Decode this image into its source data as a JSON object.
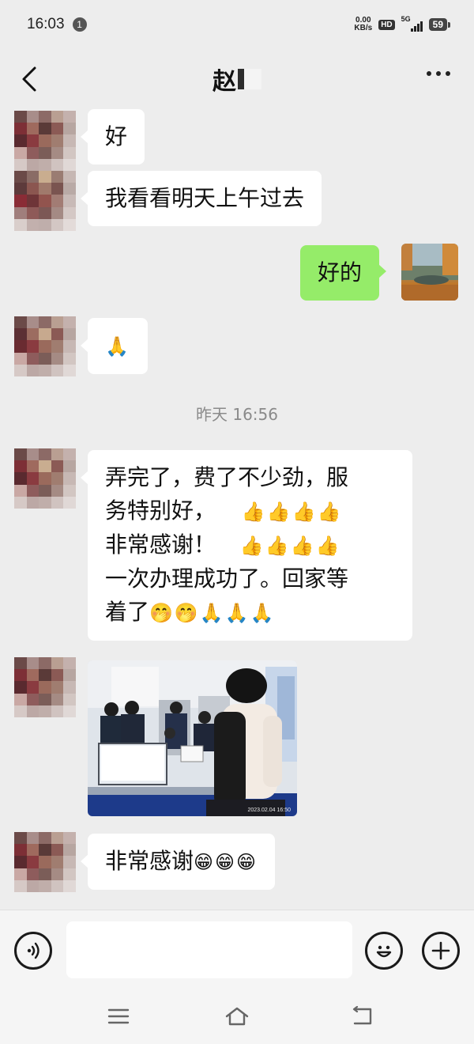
{
  "status_bar": {
    "time": "16:03",
    "notification_count": "1",
    "net_speed_value": "0.00",
    "net_speed_unit": "KB/s",
    "hd_label": "HD",
    "network_label": "5G",
    "battery_level": "59"
  },
  "header": {
    "title": "赵",
    "back_icon": "chevron-left-icon",
    "more_icon": "ellipsis-icon"
  },
  "messages": [
    {
      "side": "left",
      "text": "好"
    },
    {
      "side": "left",
      "text": "我看看明天上午过去"
    },
    {
      "side": "right",
      "text": "好的"
    },
    {
      "side": "left",
      "emoji": "🙏"
    }
  ],
  "timestamp": "昨天 16:56",
  "long_message": {
    "line1": "弄完了，费了不少劲，服",
    "line2_text": "务特别好，",
    "line2_emoji": "👍👍👍👍",
    "line3_text": "非常感谢！",
    "line3_emoji": "👍👍👍👍",
    "line4": "一次办理成功了。回家等",
    "line5_text": "着了",
    "line5_emoji": "🤭🤭🙏🙏🙏"
  },
  "photo": {
    "caption_timestamp": "2023.02.04 16:50"
  },
  "last_message": {
    "text": "非常感谢",
    "emoji": "😁😁😁"
  },
  "input_bar": {
    "placeholder": "",
    "voice_icon": "voice-icon",
    "emoji_icon": "emoji-icon",
    "add_icon": "plus-icon"
  },
  "nav_bar": {
    "menu_icon": "menu-icon",
    "home_icon": "home-icon",
    "back_icon": "back-icon"
  },
  "colors": {
    "background": "#ededed",
    "self_bubble": "#95ec69",
    "other_bubble": "#ffffff",
    "timestamp_text": "#8a8a8a"
  }
}
